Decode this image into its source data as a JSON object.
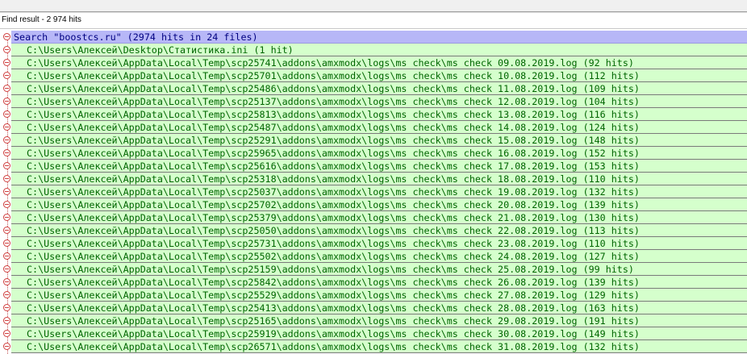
{
  "panel": {
    "title": "Find result - 2 974 hits"
  },
  "search": {
    "label": "Search \"boostcs.ru\" (2974 hits in 24 files)"
  },
  "files": [
    "C:\\Users\\Алексей\\Desktop\\Статистика.ini (1 hit)",
    "C:\\Users\\Алексей\\AppData\\Local\\Temp\\scp25741\\addons\\amxmodx\\logs\\ms check\\ms check 09.08.2019.log (92 hits)",
    "C:\\Users\\Алексей\\AppData\\Local\\Temp\\scp25701\\addons\\amxmodx\\logs\\ms check\\ms check 10.08.2019.log (112 hits)",
    "C:\\Users\\Алексей\\AppData\\Local\\Temp\\scp25486\\addons\\amxmodx\\logs\\ms check\\ms check 11.08.2019.log (109 hits)",
    "C:\\Users\\Алексей\\AppData\\Local\\Temp\\scp25137\\addons\\amxmodx\\logs\\ms check\\ms check 12.08.2019.log (104 hits)",
    "C:\\Users\\Алексей\\AppData\\Local\\Temp\\scp25813\\addons\\amxmodx\\logs\\ms check\\ms check 13.08.2019.log (116 hits)",
    "C:\\Users\\Алексей\\AppData\\Local\\Temp\\scp25487\\addons\\amxmodx\\logs\\ms check\\ms check 14.08.2019.log (124 hits)",
    "C:\\Users\\Алексей\\AppData\\Local\\Temp\\scp25291\\addons\\amxmodx\\logs\\ms check\\ms check 15.08.2019.log (148 hits)",
    "C:\\Users\\Алексей\\AppData\\Local\\Temp\\scp25965\\addons\\amxmodx\\logs\\ms check\\ms check 16.08.2019.log (152 hits)",
    "C:\\Users\\Алексей\\AppData\\Local\\Temp\\scp25616\\addons\\amxmodx\\logs\\ms check\\ms check 17.08.2019.log (153 hits)",
    "C:\\Users\\Алексей\\AppData\\Local\\Temp\\scp25318\\addons\\amxmodx\\logs\\ms check\\ms check 18.08.2019.log (110 hits)",
    "C:\\Users\\Алексей\\AppData\\Local\\Temp\\scp25037\\addons\\amxmodx\\logs\\ms check\\ms check 19.08.2019.log (132 hits)",
    "C:\\Users\\Алексей\\AppData\\Local\\Temp\\scp25702\\addons\\amxmodx\\logs\\ms check\\ms check 20.08.2019.log (139 hits)",
    "C:\\Users\\Алексей\\AppData\\Local\\Temp\\scp25379\\addons\\amxmodx\\logs\\ms check\\ms check 21.08.2019.log (130 hits)",
    "C:\\Users\\Алексей\\AppData\\Local\\Temp\\scp25050\\addons\\amxmodx\\logs\\ms check\\ms check 22.08.2019.log (113 hits)",
    "C:\\Users\\Алексей\\AppData\\Local\\Temp\\scp25731\\addons\\amxmodx\\logs\\ms check\\ms check 23.08.2019.log (110 hits)",
    "C:\\Users\\Алексей\\AppData\\Local\\Temp\\scp25502\\addons\\amxmodx\\logs\\ms check\\ms check 24.08.2019.log (127 hits)",
    "C:\\Users\\Алексей\\AppData\\Local\\Temp\\scp25159\\addons\\amxmodx\\logs\\ms check\\ms check 25.08.2019.log (99 hits)",
    "C:\\Users\\Алексей\\AppData\\Local\\Temp\\scp25842\\addons\\amxmodx\\logs\\ms check\\ms check 26.08.2019.log (139 hits)",
    "C:\\Users\\Алексей\\AppData\\Local\\Temp\\scp25529\\addons\\amxmodx\\logs\\ms check\\ms check 27.08.2019.log (129 hits)",
    "C:\\Users\\Алексей\\AppData\\Local\\Temp\\scp25413\\addons\\amxmodx\\logs\\ms check\\ms check 28.08.2019.log (163 hits)",
    "C:\\Users\\Алексей\\AppData\\Local\\Temp\\scp25165\\addons\\amxmodx\\logs\\ms check\\ms check 29.08.2019.log (191 hits)",
    "C:\\Users\\Алексей\\AppData\\Local\\Temp\\scp25919\\addons\\amxmodx\\logs\\ms check\\ms check 30.08.2019.log (149 hits)",
    "C:\\Users\\Алексей\\AppData\\Local\\Temp\\scp26571\\addons\\amxmodx\\logs\\ms check\\ms check 31.08.2019.log (132 hits)"
  ],
  "colors": {
    "search_row_bg": "#b7b7f7",
    "search_row_text": "#000080",
    "file_row_bg": "#d5ffcc",
    "file_row_text": "#006400",
    "tree_node": "#d04040"
  },
  "icons": {
    "collapse_node": "collapse-node-icon"
  }
}
